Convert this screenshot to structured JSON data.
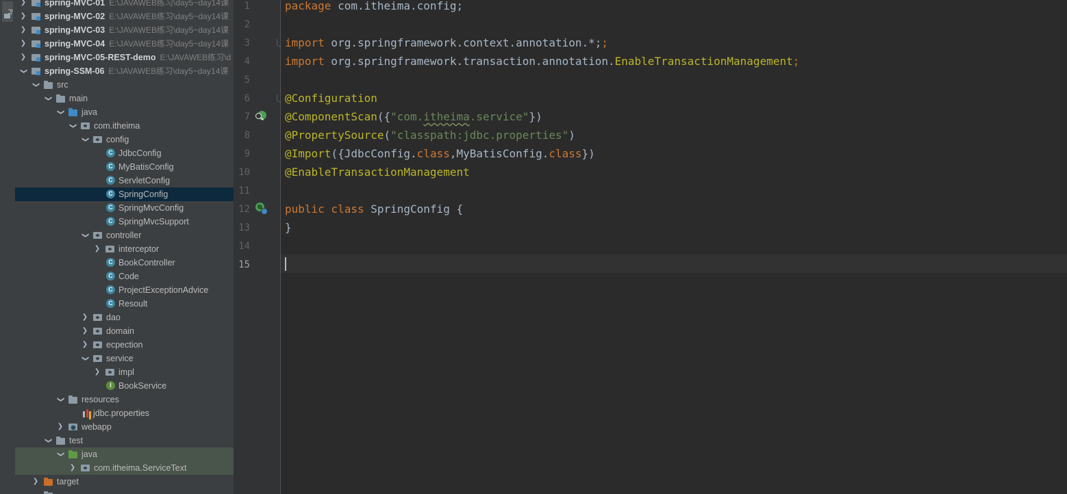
{
  "tool_window": {
    "label": "Pr"
  },
  "project_tree": {
    "rows": [
      {
        "label": "spring-MVC-01",
        "path": "E:\\JAVAWEB练习\\day5~day14课"
      },
      {
        "label": "spring-MVC-02",
        "path": "E:\\JAVAWEB练习\\day5~day14课"
      },
      {
        "label": "spring-MVC-03",
        "path": "E:\\JAVAWEB练习\\day5~day14课"
      },
      {
        "label": "spring-MVC-04",
        "path": "E:\\JAVAWEB练习\\day5~day14课"
      },
      {
        "label": "spring-MVC-05-REST-demo",
        "path": "E:\\JAVAWEB练习\\d"
      },
      {
        "label": "spring-SSM-06",
        "path": "E:\\JAVAWEB练习\\day5~day14课"
      },
      {
        "label": "src"
      },
      {
        "label": "main"
      },
      {
        "label": "java"
      },
      {
        "label": "com.itheima"
      },
      {
        "label": "config"
      },
      {
        "label": "JdbcConfig"
      },
      {
        "label": "MyBatisConfig"
      },
      {
        "label": "ServletConfig"
      },
      {
        "label": "SpringConfig"
      },
      {
        "label": "SpringMvcConfig"
      },
      {
        "label": "SpringMvcSupport"
      },
      {
        "label": "controller"
      },
      {
        "label": "interceptor"
      },
      {
        "label": "BookController"
      },
      {
        "label": "Code"
      },
      {
        "label": "ProjectExceptionAdvice"
      },
      {
        "label": "Resoult"
      },
      {
        "label": "dao"
      },
      {
        "label": "domain"
      },
      {
        "label": "ecpection"
      },
      {
        "label": "service"
      },
      {
        "label": "impl"
      },
      {
        "label": "BookService"
      },
      {
        "label": "resources"
      },
      {
        "label": "jdbc.properties"
      },
      {
        "label": "webapp"
      },
      {
        "label": "test"
      },
      {
        "label": "java"
      },
      {
        "label": "com.itheima.ServiceText"
      },
      {
        "label": "target"
      }
    ],
    "class_icon_letter": "C",
    "interface_icon_letter": "I"
  },
  "editor": {
    "line_numbers": [
      "1",
      "2",
      "3",
      "4",
      "5",
      "6",
      "7",
      "8",
      "9",
      "10",
      "11",
      "12",
      "13",
      "14",
      "15"
    ],
    "code": {
      "l1_kw": "package",
      "l1_rest": " com.itheima.config;",
      "l3_kw": "import",
      "l3_rest": " org.springframework.context.annotation.*;",
      "l4_kw": "import",
      "l4_pkg": " org.springframework.transaction.annotation.",
      "l4_cls": "EnableTransactionManagement",
      "l4_semi": ";",
      "l6_ann": "@Configuration",
      "l7_ann": "@ComponentScan",
      "l7_open": "({",
      "l7_str_a": "\"com.",
      "l7_str_b": "itheima",
      "l7_str_c": ".service\"",
      "l7_close": "})",
      "l8_ann": "@PropertySource",
      "l8_open": "(",
      "l8_str": "\"classpath:jdbc.properties\"",
      "l8_close": ")",
      "l9_ann": "@Import",
      "l9_a": "({JdbcConfig.",
      "l9_kw1": "class",
      "l9_b": ",MyBatisConfig.",
      "l9_kw2": "class",
      "l9_c": "})",
      "l10_ann": "@EnableTransactionManagement",
      "l12_kw": "public class",
      "l12_rest": " SpringConfig {",
      "l13": "}"
    }
  },
  "colors": {
    "keyword": "#cc7832",
    "annotation": "#bbb529",
    "string": "#6a8759",
    "plain": "#a9b7c6",
    "selection": "#0d293e"
  }
}
